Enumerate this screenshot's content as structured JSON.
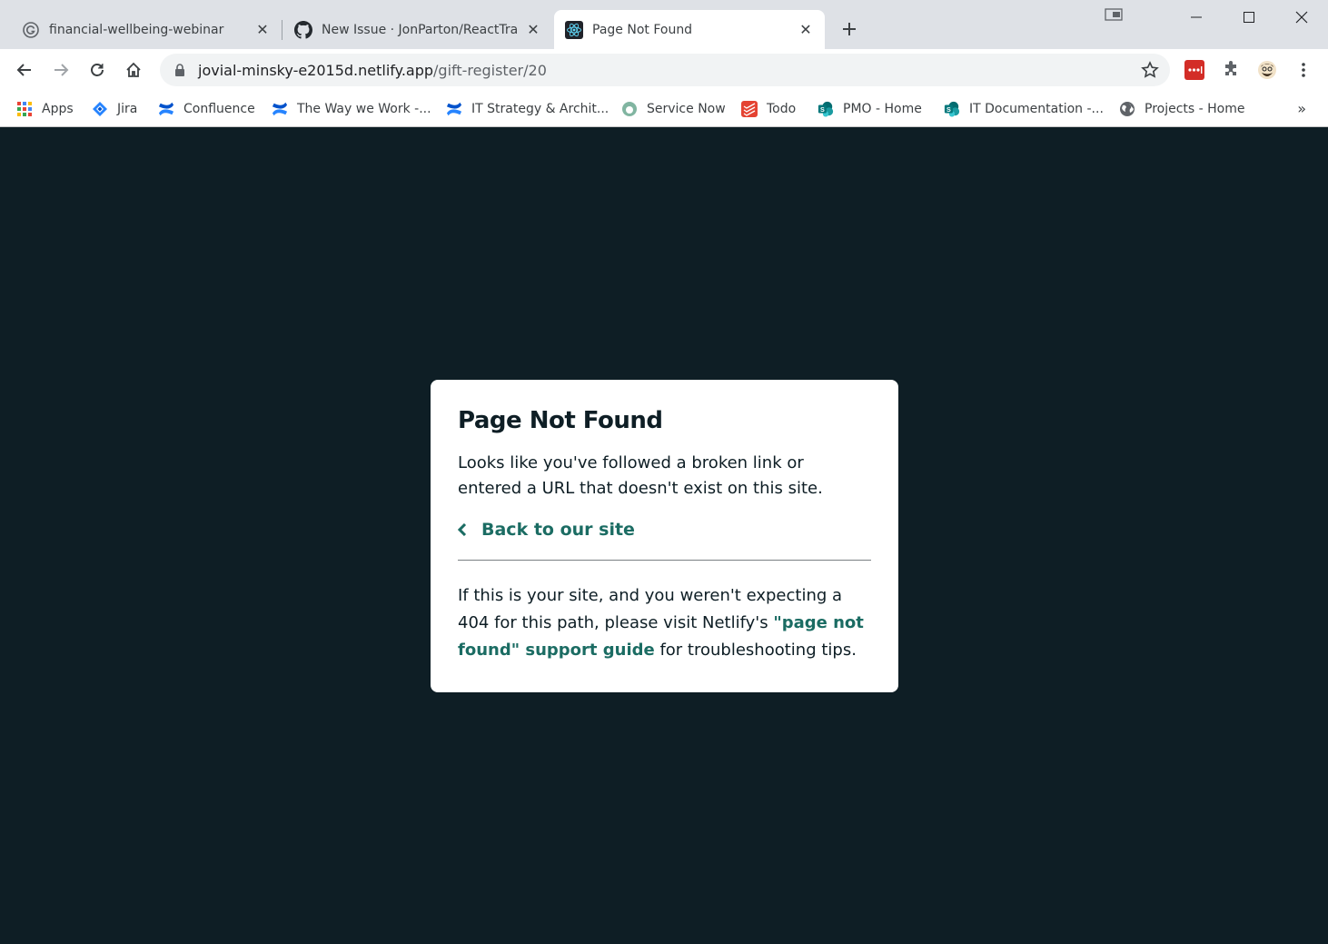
{
  "tabs": [
    {
      "title": "financial-wellbeing-webinar",
      "icon": "grammarly-icon",
      "active": false
    },
    {
      "title": "New Issue · JonParton/ReactTrain",
      "icon": "github-icon",
      "active": false
    },
    {
      "title": "Page Not Found",
      "icon": "react-icon",
      "active": true
    }
  ],
  "omnibox": {
    "host": "jovial-minsky-e2015d.netlify.app",
    "path": "/gift-register/20"
  },
  "bookmarks": [
    {
      "label": "Apps",
      "icon": "apps-grid-icon"
    },
    {
      "label": "Jira",
      "icon": "jira-icon"
    },
    {
      "label": "Confluence",
      "icon": "confluence-icon"
    },
    {
      "label": "The Way we Work -...",
      "icon": "confluence-icon"
    },
    {
      "label": "IT Strategy & Archit...",
      "icon": "confluence-icon"
    },
    {
      "label": "Service Now",
      "icon": "servicenow-icon"
    },
    {
      "label": "Todo",
      "icon": "todoist-icon"
    },
    {
      "label": "PMO - Home",
      "icon": "sharepoint-icon"
    },
    {
      "label": "IT Documentation -...",
      "icon": "sharepoint-icon"
    },
    {
      "label": "Projects - Home",
      "icon": "globe-icon"
    }
  ],
  "bookmarks_more": "»",
  "card": {
    "title": "Page Not Found",
    "message": "Looks like you've followed a broken link or entered a URL that doesn't exist on this site.",
    "back_link": "Back to our site",
    "footer_before": "If this is your site, and you weren't expecting a 404 for this path, please visit Netlify's ",
    "footer_link": "\"page not found\" support guide",
    "footer_after": " for troubleshooting tips."
  },
  "colors": {
    "page_bg": "#0e1e25",
    "link": "#1b6c63",
    "tabstrip_bg": "#dee1e6"
  }
}
